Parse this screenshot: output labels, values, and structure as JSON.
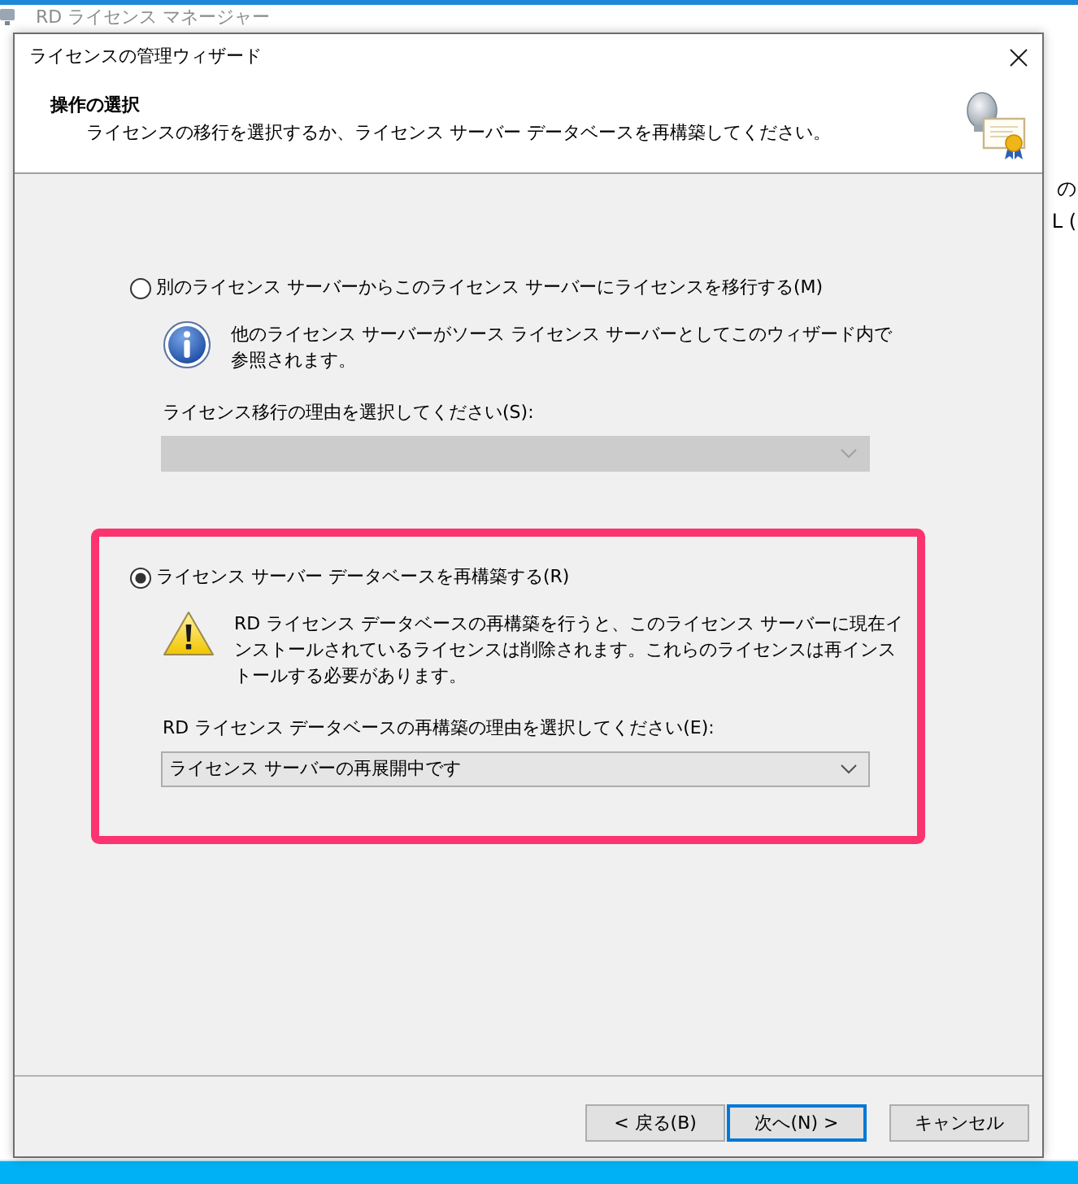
{
  "background_window": {
    "title": "RD ライセンス マネージャー",
    "fragments": [
      "の",
      "L ("
    ]
  },
  "dialog": {
    "title": "ライセンスの管理ウィザード",
    "header": {
      "heading": "操作の選択",
      "description": "ライセンスの移行を選択するか、ライセンス サーバー データベースを再構築してください。"
    },
    "options": [
      {
        "label": "別のライセンス サーバーからこのライセンス サーバーにライセンスを移行する(M)",
        "selected": false,
        "highlighted": false,
        "note": {
          "kind": "info",
          "text": "他のライセンス サーバーがソース ライセンス サーバーとしてこのウィザード内で参照されます。"
        },
        "reason_label": "ライセンス移行の理由を選択してください(S):",
        "reason_select": {
          "disabled": true
        }
      },
      {
        "label": "ライセンス サーバー データベースを再構築する(R)",
        "selected": true,
        "highlighted": true,
        "note": {
          "kind": "warning",
          "text": "RD ライセンス データベースの再構築を行うと、このライセンス サーバーに現在インストールされているライセンスは削除されます。これらのライセンスは再インストールする必要があります。"
        },
        "reason_label": "RD ライセンス データベースの再構築の理由を選択してください(E):",
        "reason_select": {
          "disabled": false,
          "value": "ライセンス サーバーの再展開中です"
        }
      }
    ],
    "buttons": [
      {
        "label": "< 戻る(B)",
        "default": false
      },
      {
        "label": "次へ(N) >",
        "default": true
      },
      {
        "label": "キャンセル",
        "default": false
      }
    ]
  }
}
